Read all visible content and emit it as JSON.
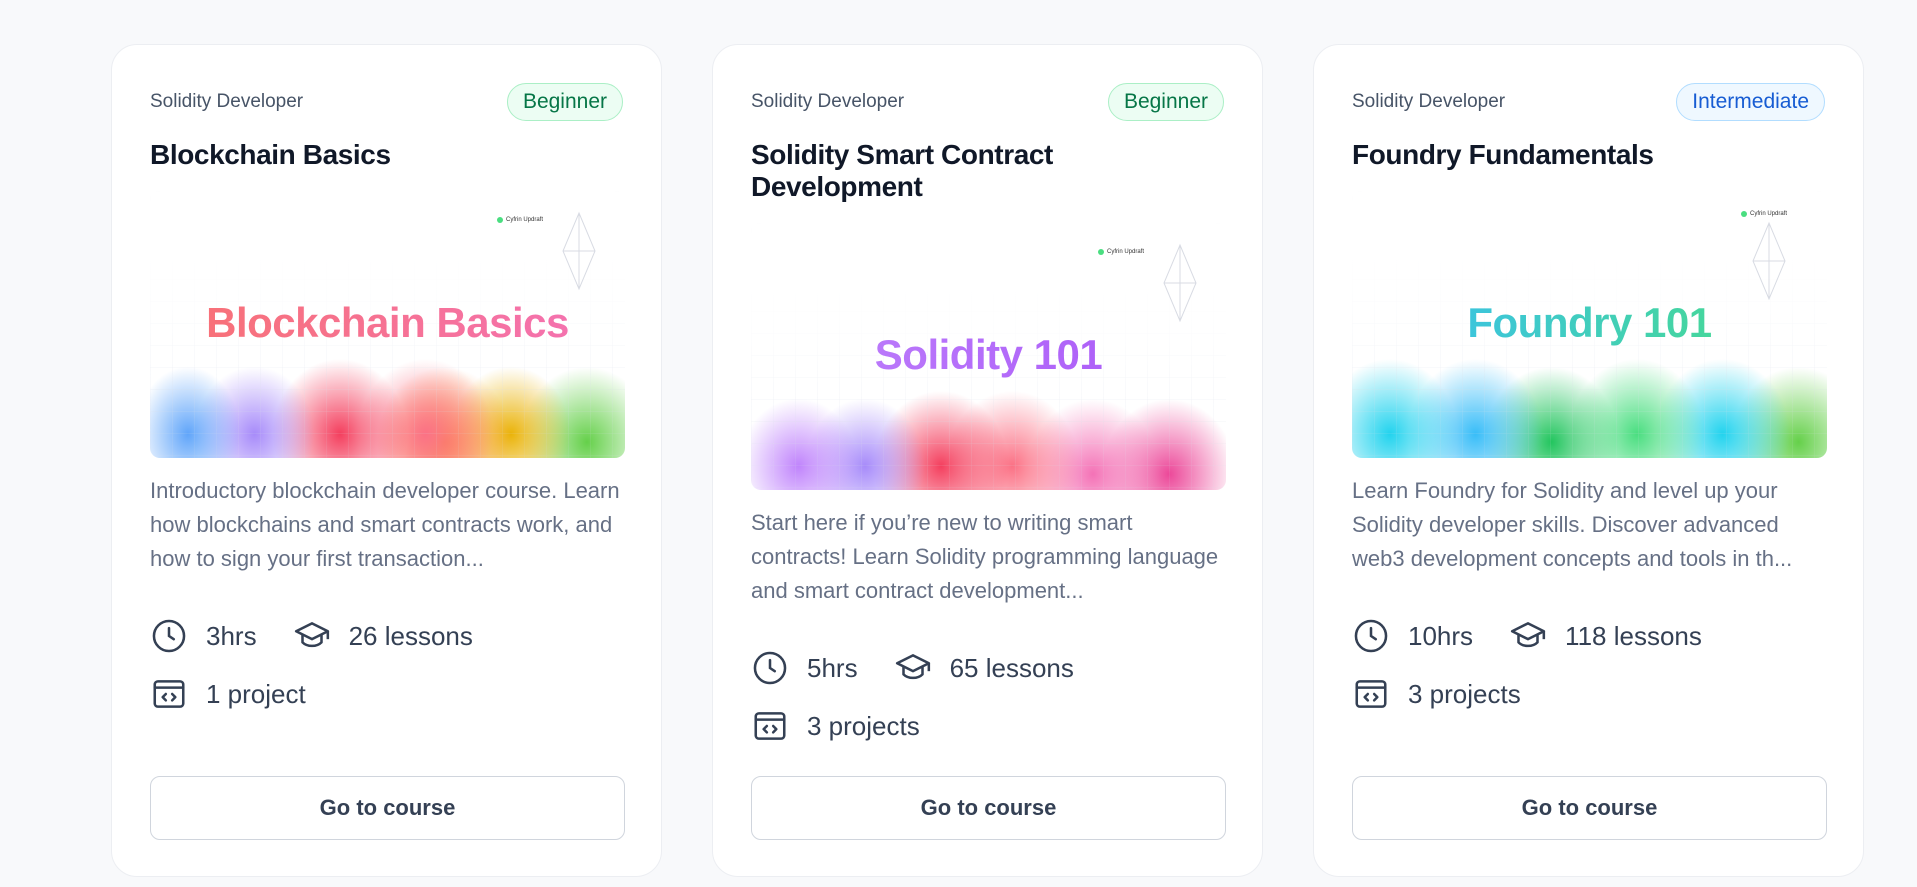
{
  "courses": [
    {
      "category": "Solidity Developer",
      "level": "Beginner",
      "title": "Blockchain Basics",
      "thumbnail_title": "Blockchain Basics",
      "thumbnail_brand": "Cyfrin Updraft",
      "description": "Introductory blockchain developer course. Learn how blockchains and smart contracts work, and how to sign your first transaction...",
      "duration": "3hrs",
      "lessons": "26 lessons",
      "projects": "1 project",
      "cta": "Go to course"
    },
    {
      "category": "Solidity Developer",
      "level": "Beginner",
      "title": "Solidity Smart Contract Development",
      "thumbnail_title": "Solidity 101",
      "thumbnail_brand": "Cyfrin Updraft",
      "description": "Start here if you’re new to writing smart contracts! Learn Solidity programming language and smart contract development...",
      "duration": "5hrs",
      "lessons": "65 lessons",
      "projects": "3 projects",
      "cta": "Go to course"
    },
    {
      "category": "Solidity Developer",
      "level": "Intermediate",
      "title": "Foundry Fundamentals",
      "thumbnail_title": "Foundry 101",
      "thumbnail_brand": "Cyfrin Updraft",
      "description": "Learn Foundry for Solidity and level up your Solidity developer skills. Discover advanced web3 development concepts and tools in th...",
      "duration": "10hrs",
      "lessons": "118 lessons",
      "projects": "3 projects",
      "cta": "Go to course"
    }
  ],
  "colors": {
    "beginner_badge": "#067647",
    "intermediate_badge": "#175cd3",
    "thumb_text_1": [
      "#f87171",
      "#f472b6"
    ],
    "thumb_text_2": [
      "#c084fc",
      "#a855f7"
    ],
    "thumb_text_3": [
      "#38bdf8",
      "#4ade80"
    ]
  },
  "icons": [
    "clock-icon",
    "graduation-cap-icon",
    "code-window-icon"
  ]
}
